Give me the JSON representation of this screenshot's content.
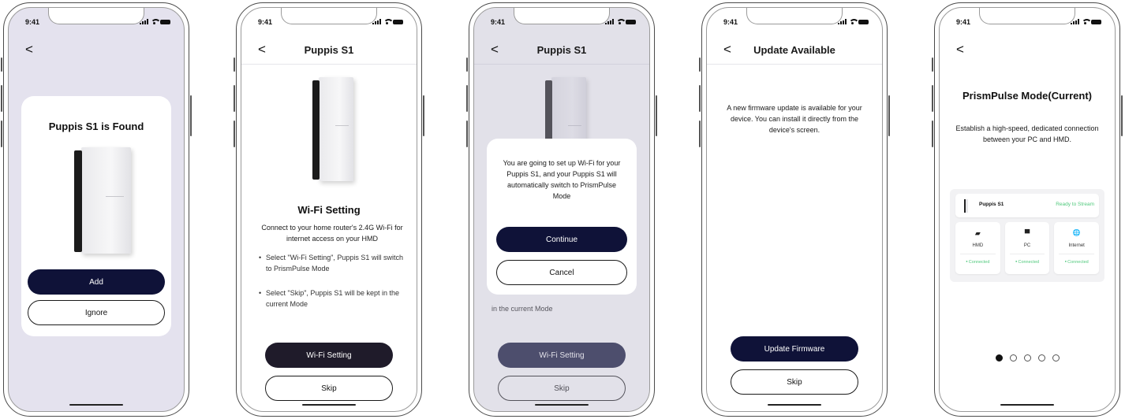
{
  "status": {
    "time": "9:41"
  },
  "screens": [
    {
      "back": "<",
      "title": "Puppis S1 is Found",
      "primary": "Add",
      "secondary": "Ignore"
    },
    {
      "back": "<",
      "nav_title": "Puppis S1",
      "section_title": "Wi-Fi Setting",
      "description": "Connect to your home router's 2.4G Wi-Fi for internet access on your HMD",
      "bullets": [
        "Select \"Wi-Fi Setting\", Puppis S1 will switch to PrismPulse Mode",
        "Select \"Skip\", Puppis S1 will be kept in the current Mode"
      ],
      "primary": "Wi-Fi Setting",
      "secondary": "Skip"
    },
    {
      "back": "<",
      "nav_title": "Puppis S1",
      "dialog_text": "You are going to set up Wi-Fi for your Puppis S1, and your Puppis S1 will automatically switch to PrismPulse Mode",
      "dialog_primary": "Continue",
      "dialog_secondary": "Cancel",
      "behind_text": "in the current Mode",
      "primary": "Wi-Fi Setting",
      "secondary": "Skip"
    },
    {
      "back": "<",
      "nav_title": "Update Available",
      "description": "A new firmware update is available for your device. You can install it directly from the device's screen.",
      "primary": "Update Firmware",
      "secondary": "Skip"
    },
    {
      "back": "<",
      "title": "PrismPulse Mode(Current)",
      "description": "Establish a high-speed, dedicated connection between your PC and HMD.",
      "device_name": "Puppis S1",
      "device_status": "Ready to Stream",
      "tiles": [
        {
          "icon": "headset-icon",
          "glyph": "▰",
          "label": "HMD",
          "status": "Connected"
        },
        {
          "icon": "monitor-icon",
          "glyph": "▀",
          "label": "PC",
          "status": "Connected"
        },
        {
          "icon": "globe-icon",
          "glyph": "🌐",
          "label": "Internet",
          "status": "Connected"
        }
      ],
      "pages": 5,
      "current_page": 1
    }
  ]
}
